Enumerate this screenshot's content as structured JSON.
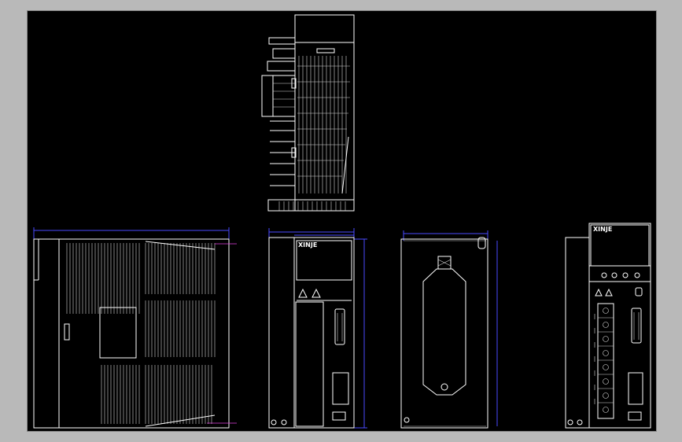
{
  "drawing": {
    "background": "#000000",
    "frame_color": "#b9b9b9",
    "line_color": "#ffffff",
    "dimension_color": "#4a4aff",
    "centerline_color": "#e040e0",
    "title_text_color": "#3a3aff"
  },
  "views": {
    "front": {
      "brand_label": "XINJE"
    },
    "rear": {
      "brand_label": "XINJE"
    }
  }
}
